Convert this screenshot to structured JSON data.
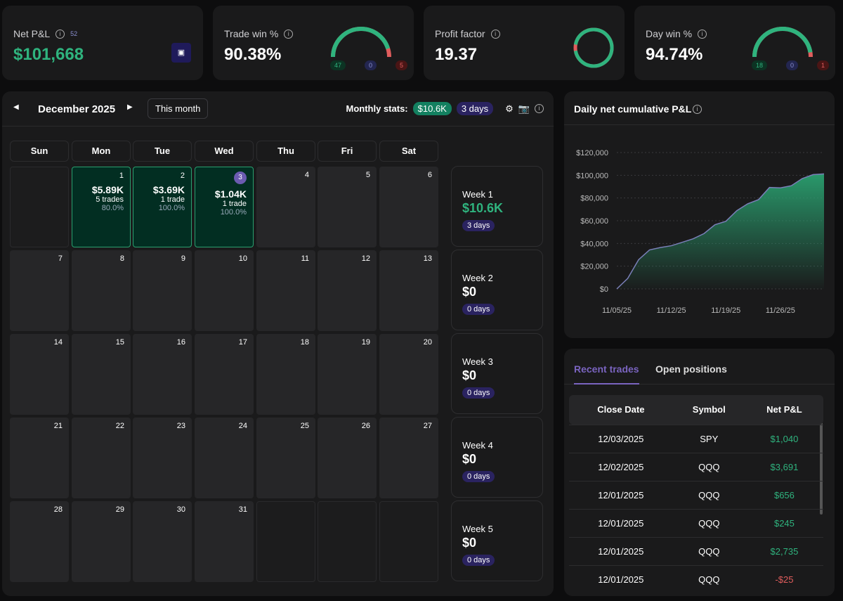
{
  "stats": {
    "net_pnl": {
      "label": "Net P&L",
      "count": "52",
      "value": "$101,668"
    },
    "trade_win": {
      "label": "Trade win %",
      "value": "90.38%",
      "win": "47",
      "even": "0",
      "loss": "5",
      "win_ratio": 0.9038
    },
    "profit_factor": {
      "label": "Profit factor",
      "value": "19.37",
      "ratio": 0.95
    },
    "day_win": {
      "label": "Day win %",
      "value": "94.74%",
      "win": "18",
      "even": "0",
      "loss": "1",
      "win_ratio": 0.9474
    }
  },
  "calendar": {
    "month": "December 2025",
    "this_month": "This month",
    "monthly_label": "Monthly stats:",
    "monthly_pnl": "$10.6K",
    "monthly_days": "3 days",
    "weekdays": [
      "Sun",
      "Mon",
      "Tue",
      "Wed",
      "Thu",
      "Fri",
      "Sat"
    ],
    "today": 3,
    "days": {
      "1": {
        "pnl": "$5.89K",
        "trades": "5 trades",
        "pct": "80.0%"
      },
      "2": {
        "pnl": "$3.69K",
        "trades": "1 trade",
        "pct": "100.0%"
      },
      "3": {
        "pnl": "$1.04K",
        "trades": "1 trade",
        "pct": "100.0%"
      }
    },
    "weeks": [
      {
        "label": "Week 1",
        "value": "$10.6K",
        "days": "3 days"
      },
      {
        "label": "Week 2",
        "value": "$0",
        "days": "0 days"
      },
      {
        "label": "Week 3",
        "value": "$0",
        "days": "0 days"
      },
      {
        "label": "Week 4",
        "value": "$0",
        "days": "0 days"
      },
      {
        "label": "Week 5",
        "value": "$0",
        "days": "0 days"
      }
    ]
  },
  "chart_data": {
    "type": "area",
    "title": "Daily net cumulative P&L",
    "x": [
      "11/05/25",
      "11/06/25",
      "11/07/25",
      "11/10/25",
      "11/11/25",
      "11/12/25",
      "11/13/25",
      "11/14/25",
      "11/17/25",
      "11/18/25",
      "11/19/25",
      "11/20/25",
      "11/21/25",
      "11/24/25",
      "11/25/25",
      "11/26/25",
      "11/27/25",
      "11/28/25",
      "12/01/25",
      "12/02/25"
    ],
    "values": [
      0,
      9200,
      25700,
      34300,
      36400,
      38000,
      41000,
      44100,
      48700,
      56500,
      59500,
      68800,
      74900,
      78600,
      89300,
      88900,
      90800,
      97100,
      100600,
      101200
    ],
    "x_ticks": [
      "11/05/25",
      "11/12/25",
      "11/19/25",
      "11/26/25"
    ],
    "y_ticks": [
      "$0",
      "$20,000",
      "$40,000",
      "$60,000",
      "$80,000",
      "$100,000",
      "$120,000"
    ],
    "ylim": [
      0,
      120000
    ],
    "grid": true,
    "line_color": "#7a7fb8",
    "fill_color": "#2a9f6f"
  },
  "trades": {
    "tabs": [
      "Recent trades",
      "Open positions"
    ],
    "columns": [
      "Close Date",
      "Symbol",
      "Net P&L"
    ],
    "rows": [
      [
        "12/03/2025",
        "SPY",
        "$1,040"
      ],
      [
        "12/02/2025",
        "QQQ",
        "$3,691"
      ],
      [
        "12/01/2025",
        "QQQ",
        "$656"
      ],
      [
        "12/01/2025",
        "QQQ",
        "$245"
      ],
      [
        "12/01/2025",
        "QQQ",
        "$2,735"
      ],
      [
        "12/01/2025",
        "QQQ",
        "-$25"
      ]
    ]
  }
}
